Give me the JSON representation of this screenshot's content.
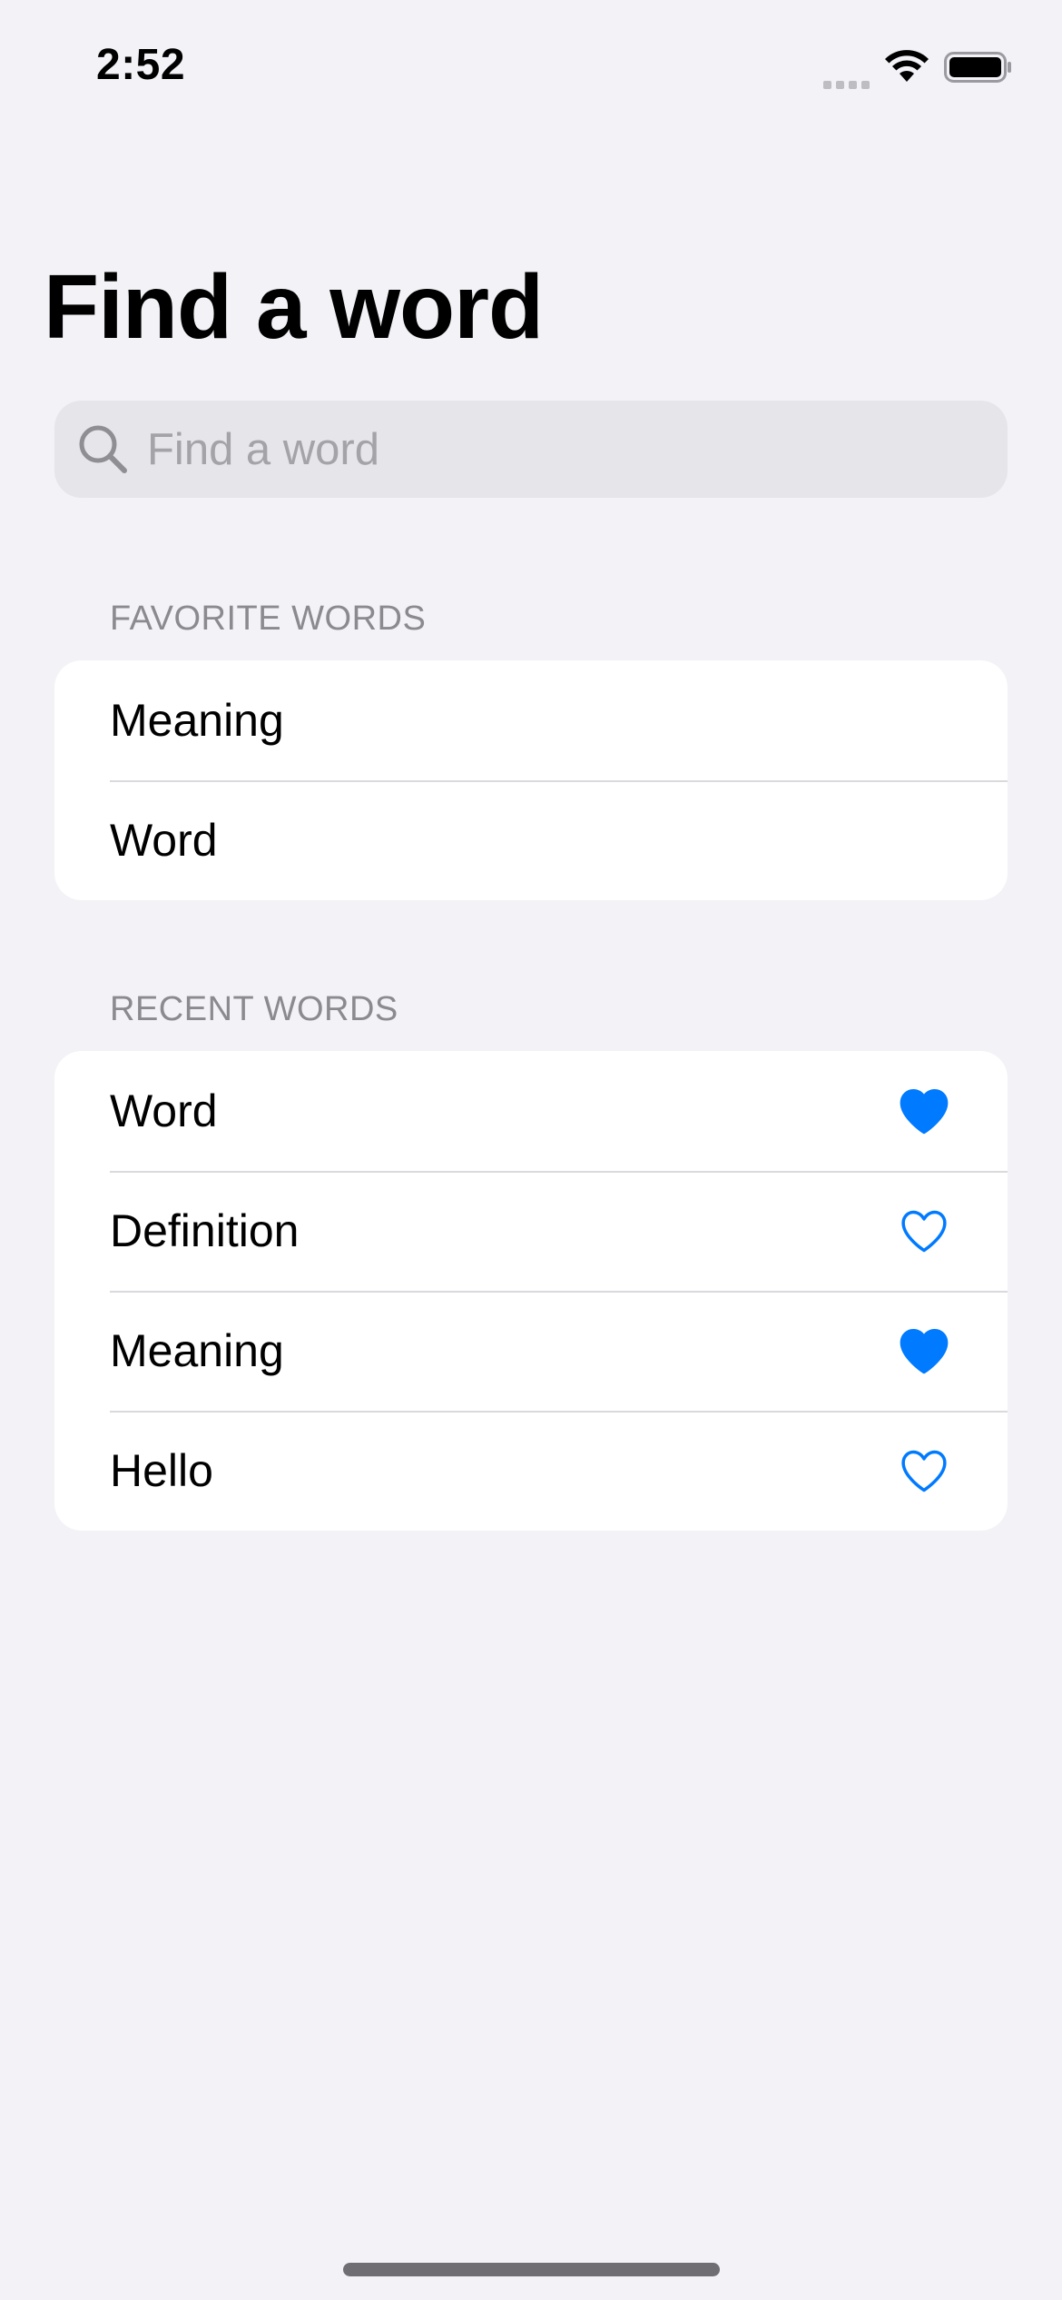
{
  "status_bar": {
    "time": "2:52"
  },
  "title": "Find a word",
  "search": {
    "placeholder": "Find a word",
    "value": ""
  },
  "favorites": {
    "header": "FAVORITE WORDS",
    "items": [
      {
        "label": "Meaning"
      },
      {
        "label": "Word"
      }
    ]
  },
  "recent": {
    "header": "RECENT WORDS",
    "items": [
      {
        "label": "Word",
        "favorited": true
      },
      {
        "label": "Definition",
        "favorited": false
      },
      {
        "label": "Meaning",
        "favorited": true
      },
      {
        "label": "Hello",
        "favorited": false
      }
    ]
  },
  "icons": {
    "search": "magnifying-glass",
    "favorite_on": "heart-fill",
    "favorite_off": "heart-outline"
  },
  "colors": {
    "background": "#F2F2F7",
    "card": "#FFFFFF",
    "accent": "#007AFF",
    "secondary_text": "#8A8A8F",
    "search_field": "#E5E5EA"
  }
}
